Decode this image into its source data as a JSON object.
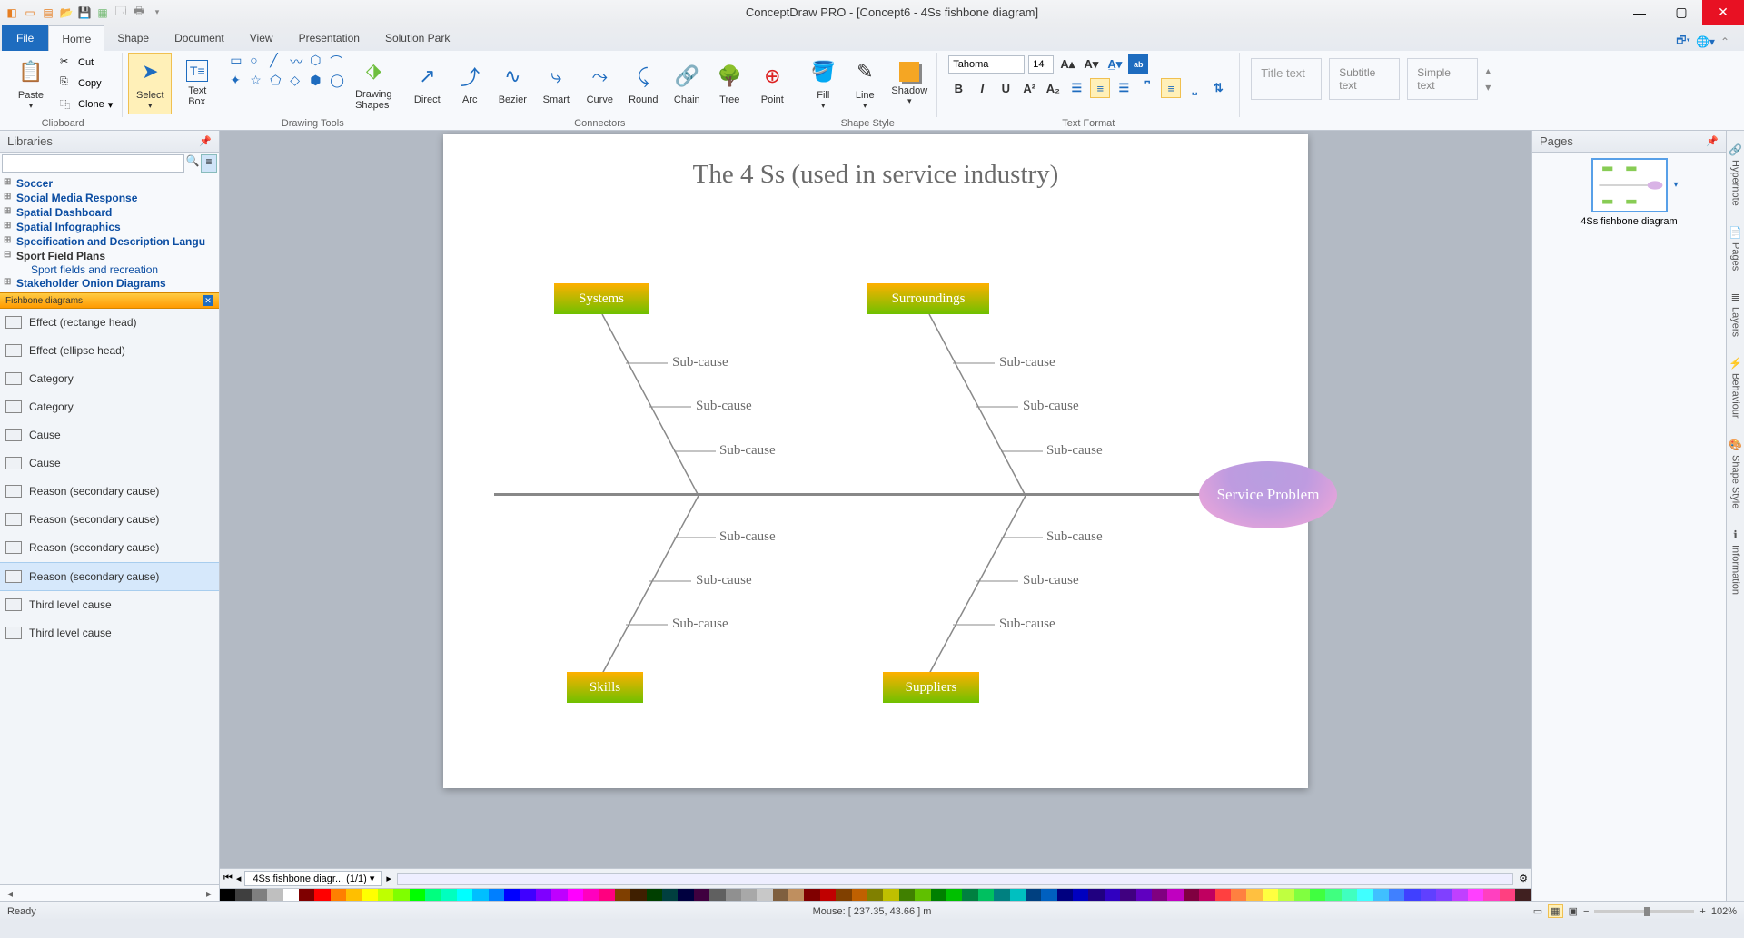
{
  "app": {
    "title": "ConceptDraw PRO - [Concept6 - 4Ss fishbone diagram]"
  },
  "tabs": {
    "file": "File",
    "items": [
      "Home",
      "Shape",
      "Document",
      "View",
      "Presentation",
      "Solution Park"
    ],
    "active": "Home"
  },
  "ribbon": {
    "clipboard": {
      "paste": "Paste",
      "cut": "Cut",
      "copy": "Copy",
      "clone": "Clone",
      "label": "Clipboard"
    },
    "select": "Select",
    "textbox": "Text\nBox",
    "drawingtools": {
      "label": "Drawing Tools",
      "shapes": "Drawing\nShapes"
    },
    "connectors": {
      "label": "Connectors",
      "direct": "Direct",
      "arc": "Arc",
      "bezier": "Bezier",
      "smart": "Smart",
      "curve": "Curve",
      "round": "Round",
      "chain": "Chain",
      "tree": "Tree",
      "point": "Point"
    },
    "shapestyle": {
      "label": "Shape Style",
      "fill": "Fill",
      "line": "Line",
      "shadow": "Shadow"
    },
    "textformat": {
      "label": "Text Format",
      "font": "Tahoma",
      "size": "14"
    },
    "titles": {
      "title": "Title text",
      "subtitle": "Subtitle text",
      "simple": "Simple text"
    }
  },
  "libraries": {
    "header": "Libraries",
    "tree": [
      "Soccer",
      "Social Media Response",
      "Spatial Dashboard",
      "Spatial Infographics",
      "Specification and Description Langu",
      "Sport Field Plans",
      "Stakeholder Onion Diagrams"
    ],
    "subcat": "Sport fields and recreation",
    "fishbone_hdr": "Fishbone diagrams",
    "shapes": [
      "Effect (rectange head)",
      "Effect (ellipse head)",
      "Category",
      "Category",
      "Cause",
      "Cause",
      "Reason (secondary cause)",
      "Reason (secondary cause)",
      "Reason (secondary cause)",
      "Reason (secondary cause)",
      "Third level cause",
      "Third level cause"
    ]
  },
  "pages_panel": {
    "header": "Pages",
    "thumb_label": "4Ss fishbone diagram"
  },
  "vtabs": [
    "Hypernote",
    "Pages",
    "Layers",
    "Behaviour",
    "Shape Style",
    "Information"
  ],
  "sheet": {
    "tab": "4Ss fishbone diagr... (1/1)"
  },
  "status": {
    "ready": "Ready",
    "mouse": "Mouse: [ 237.35, 43.66 ] m",
    "zoom": "102%"
  },
  "diagram": {
    "title": "The 4 Ss (used in service industry)",
    "head": "Service Problem",
    "causes": {
      "systems": "Systems",
      "surroundings": "Surroundings",
      "skills": "Skills",
      "suppliers": "Suppliers"
    },
    "subcause": "Sub-cause"
  },
  "palette_colors": [
    "#000000",
    "#3f3f3f",
    "#7f7f7f",
    "#bfbfbf",
    "#ffffff",
    "#7f0000",
    "#ff0000",
    "#ff7f00",
    "#ffbf00",
    "#ffff00",
    "#bfff00",
    "#7fff00",
    "#00ff00",
    "#00ff7f",
    "#00ffbf",
    "#00ffff",
    "#00bfff",
    "#007fff",
    "#0000ff",
    "#3f00ff",
    "#7f00ff",
    "#bf00ff",
    "#ff00ff",
    "#ff00bf",
    "#ff007f",
    "#7f3f00",
    "#3f1f00",
    "#003f00",
    "#003f3f",
    "#00003f",
    "#3f003f",
    "#606060",
    "#909090",
    "#a8a8a8",
    "#c8c8c8",
    "#7f5f3f",
    "#bf8f5f",
    "#800000",
    "#c00000",
    "#804000",
    "#c06000",
    "#808000",
    "#c0c000",
    "#408000",
    "#60c000",
    "#008000",
    "#00c000",
    "#008040",
    "#00c060",
    "#008080",
    "#00c0c0",
    "#004080",
    "#0060c0",
    "#000080",
    "#0000c0",
    "#200080",
    "#3000c0",
    "#400080",
    "#6000c0",
    "#800080",
    "#c000c0",
    "#800040",
    "#c00060",
    "#ff4040",
    "#ff8040",
    "#ffc040",
    "#ffff40",
    "#c0ff40",
    "#80ff40",
    "#40ff40",
    "#40ff80",
    "#40ffc0",
    "#40ffff",
    "#40c0ff",
    "#4080ff",
    "#4040ff",
    "#6040ff",
    "#8040ff",
    "#c040ff",
    "#ff40ff",
    "#ff40c0",
    "#ff4080",
    "#402020"
  ]
}
